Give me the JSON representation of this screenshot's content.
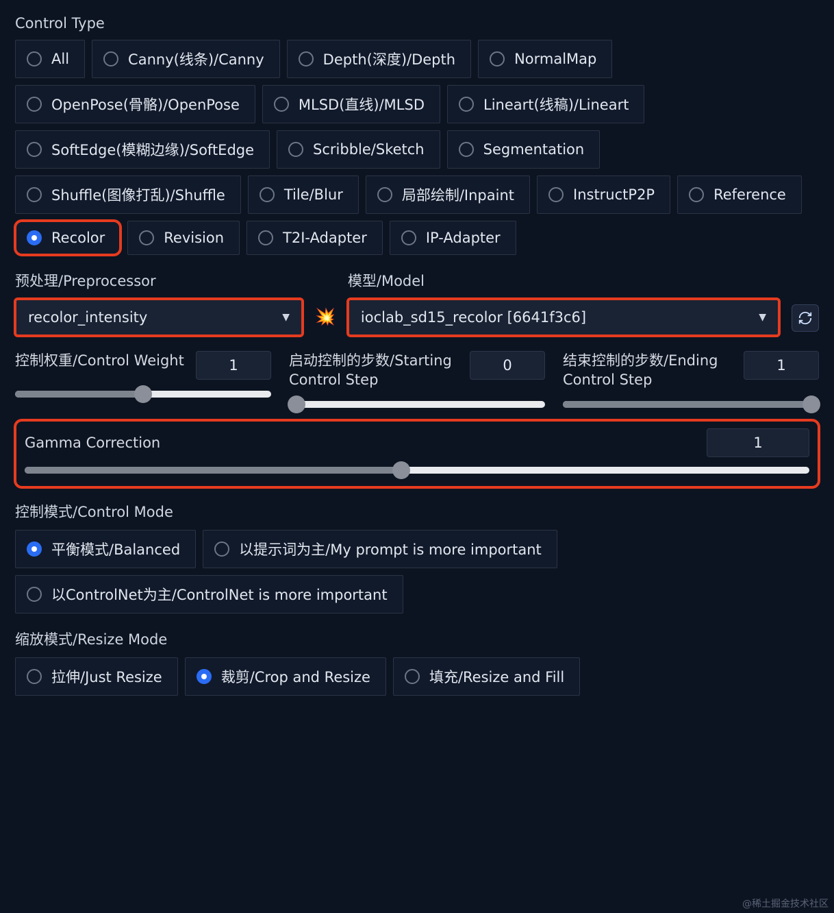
{
  "controlType": {
    "label": "Control Type",
    "selected": "Recolor",
    "options": [
      "All",
      "Canny(线条)/Canny",
      "Depth(深度)/Depth",
      "NormalMap",
      "OpenPose(骨骼)/OpenPose",
      "MLSD(直线)/MLSD",
      "Lineart(线稿)/Lineart",
      "SoftEdge(模糊边缘)/SoftEdge",
      "Scribble/Sketch",
      "Segmentation",
      "Shuffle(图像打乱)/Shuffle",
      "Tile/Blur",
      "局部绘制/Inpaint",
      "InstructP2P",
      "Reference",
      "Recolor",
      "Revision",
      "T2I-Adapter",
      "IP-Adapter"
    ]
  },
  "preprocessor": {
    "label": "预处理/Preprocessor",
    "value": "recolor_intensity"
  },
  "model": {
    "label": "模型/Model",
    "value": "ioclab_sd15_recolor [6641f3c6]"
  },
  "sparkIcon": "💥",
  "sliders": {
    "weight": {
      "label": "控制权重/Control Weight",
      "value": "1",
      "fillPct": 50,
      "thumbPct": 50
    },
    "start": {
      "label": "启动控制的步数/Starting Control Step",
      "value": "0",
      "fillPct": 0,
      "thumbPct": 3
    },
    "end": {
      "label": "结束控制的步数/Ending Control Step",
      "value": "1",
      "fillPct": 100,
      "thumbPct": 97
    }
  },
  "gamma": {
    "label": "Gamma Correction",
    "value": "1",
    "fillPct": 48,
    "thumbPct": 48
  },
  "controlMode": {
    "label": "控制模式/Control Mode",
    "selected": "平衡模式/Balanced",
    "options": [
      "平衡模式/Balanced",
      "以提示词为主/My prompt is more important",
      "以ControlNet为主/ControlNet is more important"
    ]
  },
  "resizeMode": {
    "label": "缩放模式/Resize Mode",
    "selected": "裁剪/Crop and Resize",
    "options": [
      "拉伸/Just Resize",
      "裁剪/Crop and Resize",
      "填充/Resize and Fill"
    ]
  },
  "watermark": "@稀土掘金技术社区"
}
